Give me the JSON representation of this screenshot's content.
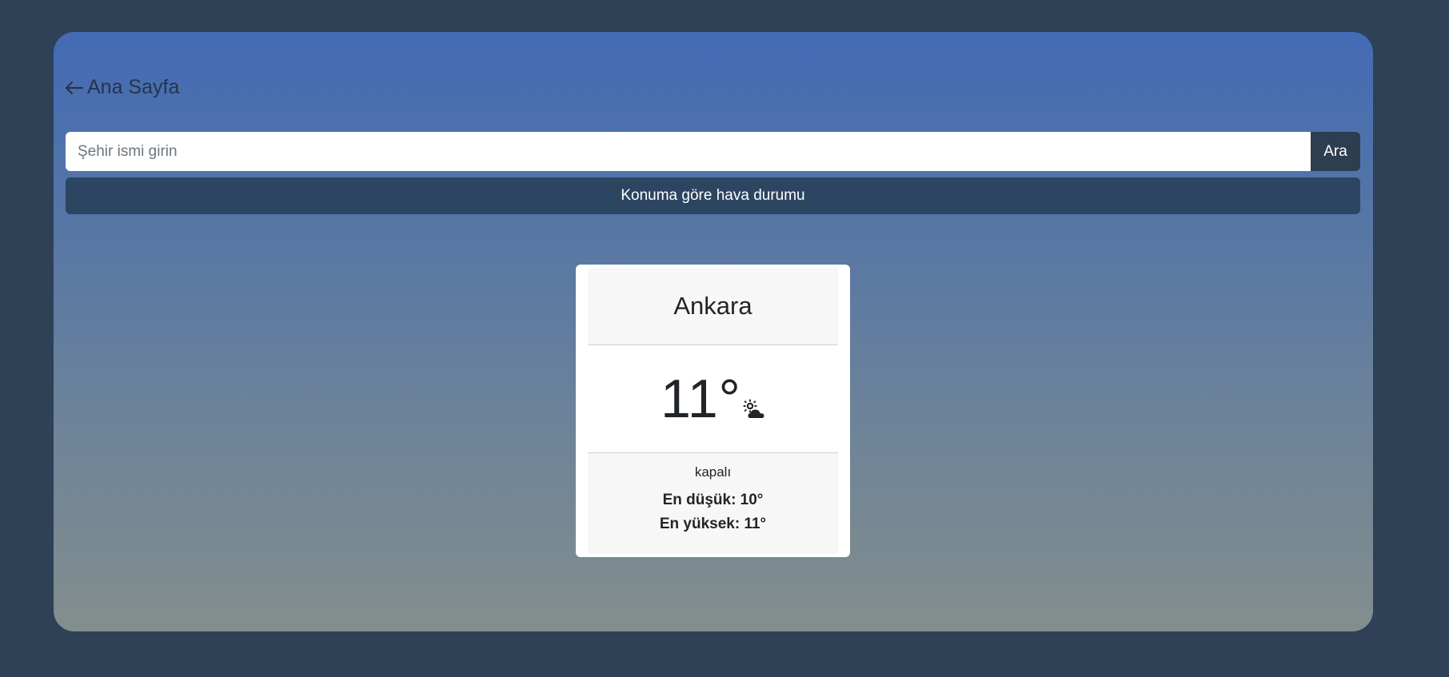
{
  "nav": {
    "back_label": "Ana Sayfa"
  },
  "search": {
    "placeholder": "Şehir ismi girin",
    "value": "",
    "button_label": "Ara"
  },
  "location_button_label": "Konuma göre hava durumu",
  "weather": {
    "city": "Ankara",
    "temperature": "11°",
    "icon": "cloud-sun-icon",
    "description": "kapalı",
    "min_label": "En düşük: 10°",
    "max_label": "En yüksek: 11°"
  },
  "colors": {
    "page_background": "#2f4157",
    "panel_gradient_top": "#436bb5",
    "panel_gradient_bottom": "#838e8d",
    "button_dark": "#2c3e50",
    "location_button": "#2c4560"
  }
}
